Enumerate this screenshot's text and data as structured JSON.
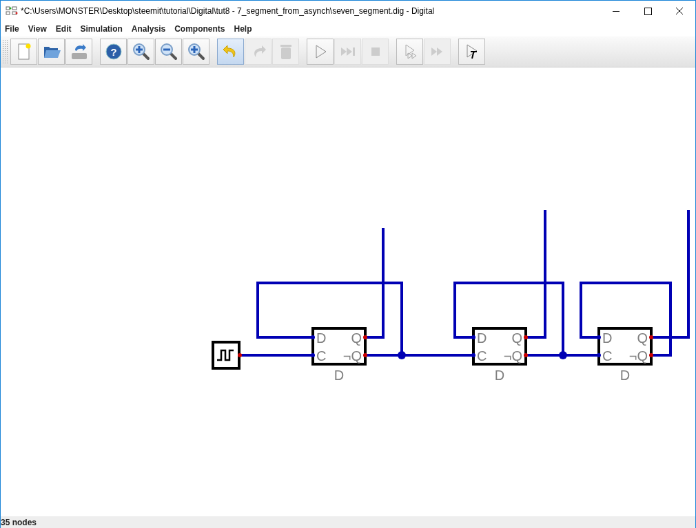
{
  "window": {
    "title": "*C:\\Users\\MONSTER\\Desktop\\steemit\\tutorial\\Digital\\tut8 - 7_segment_from_asynch\\seven_segment.dig - Digital"
  },
  "menu": [
    "File",
    "View",
    "Edit",
    "Simulation",
    "Analysis",
    "Components",
    "Help"
  ],
  "toolbar": [
    [
      {
        "kind": "new",
        "disabled": false,
        "highlighted": false
      },
      {
        "kind": "open",
        "disabled": false,
        "highlighted": false
      },
      {
        "kind": "save",
        "disabled": false,
        "highlighted": false
      }
    ],
    [
      {
        "kind": "help",
        "symbol": "?",
        "disabled": false,
        "highlighted": false
      },
      {
        "kind": "zoom-in",
        "disabled": false,
        "highlighted": false
      },
      {
        "kind": "zoom-out",
        "disabled": false,
        "highlighted": false
      },
      {
        "kind": "zoom-fit",
        "disabled": false,
        "highlighted": false
      }
    ],
    [
      {
        "kind": "undo",
        "disabled": false,
        "highlighted": true
      },
      {
        "kind": "redo",
        "disabled": true,
        "highlighted": false
      },
      {
        "kind": "delete",
        "disabled": true,
        "highlighted": false
      }
    ],
    [
      {
        "kind": "run",
        "disabled": false,
        "highlighted": false
      },
      {
        "kind": "step",
        "disabled": true,
        "highlighted": false
      },
      {
        "kind": "stop",
        "disabled": true,
        "highlighted": false
      }
    ],
    [
      {
        "kind": "run-to-break",
        "disabled": false,
        "highlighted": false
      },
      {
        "kind": "fast",
        "disabled": true,
        "highlighted": false
      }
    ],
    [
      {
        "kind": "test",
        "disabled": false,
        "highlighted": false
      }
    ]
  ],
  "circuit": {
    "flip_flops": [
      {
        "name": "D",
        "pins": {
          "d": "D",
          "c": "C",
          "q": "Q",
          "nq": "¬Q"
        }
      },
      {
        "name": "D",
        "pins": {
          "d": "D",
          "c": "C",
          "q": "Q",
          "nq": "¬Q"
        }
      },
      {
        "name": "D",
        "pins": {
          "d": "D",
          "c": "C",
          "q": "Q",
          "nq": "¬Q"
        }
      }
    ]
  },
  "status_bar": "35 nodes"
}
